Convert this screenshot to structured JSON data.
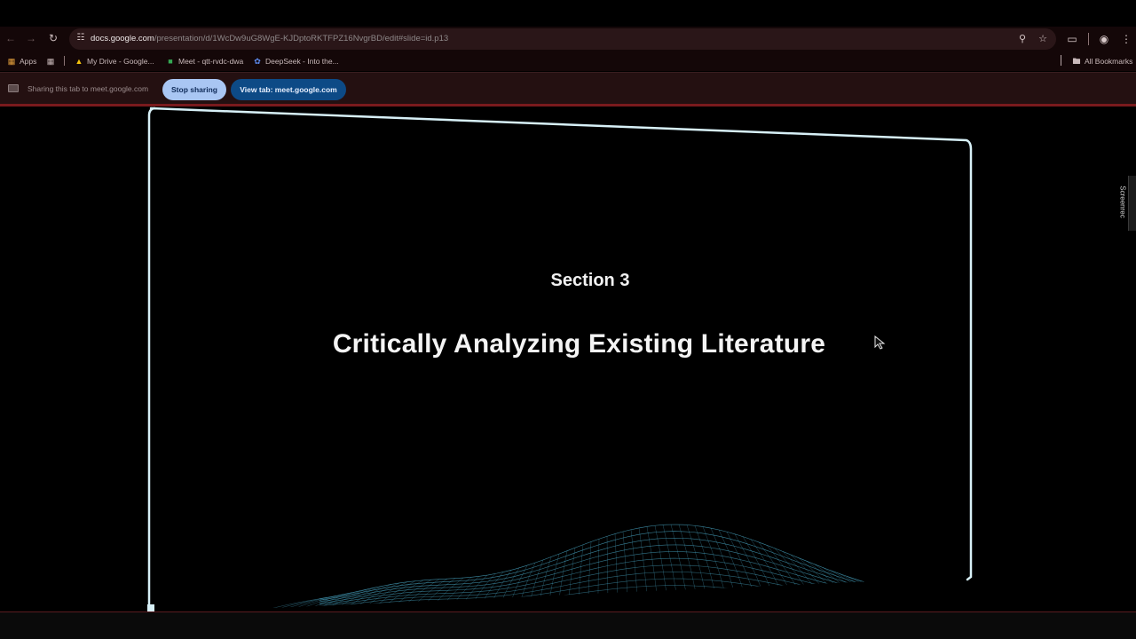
{
  "browser": {
    "url_host": "docs.google.com",
    "url_path": "/presentation/d/1WcDw9uG8WgE-KJDptoRKTFPZ16NvgrBD/edit#slide=id.p13",
    "icons": [
      "back-arrow-icon",
      "forward-arrow-icon",
      "reload-icon",
      "site-settings-icon",
      "zoom-icon",
      "star-icon",
      "extensions-icon",
      "profile-icon",
      "kebab-menu-icon"
    ]
  },
  "bookmarks": {
    "items": [
      {
        "label": "Apps",
        "icon": "apps-grid-icon"
      },
      {
        "label": "",
        "icon": "tab-groups-icon"
      },
      {
        "label": "My Drive - Google...",
        "icon": "drive-icon"
      },
      {
        "label": "Meet - qtt-rvdc-dwa",
        "icon": "meet-icon"
      },
      {
        "label": "DeepSeek - Into the...",
        "icon": "deepseek-icon"
      }
    ],
    "all_label": "All Bookmarks"
  },
  "sharebar": {
    "text": "Sharing this tab to meet.google.com",
    "stop_label": "Stop sharing",
    "view_label": "View tab: meet.google.com"
  },
  "slide": {
    "section": "Section 3",
    "title": "Critically Analyzing Existing Literature"
  },
  "side_tab": {
    "label": "Screenrec"
  },
  "colors": {
    "browser_bg": "#140708",
    "omnibox_bg": "#2a1618",
    "sharebar_bg": "#241011",
    "stop_button": "#a9c6f3",
    "view_button": "#0d4a86",
    "wave": "#4fb6d6"
  }
}
